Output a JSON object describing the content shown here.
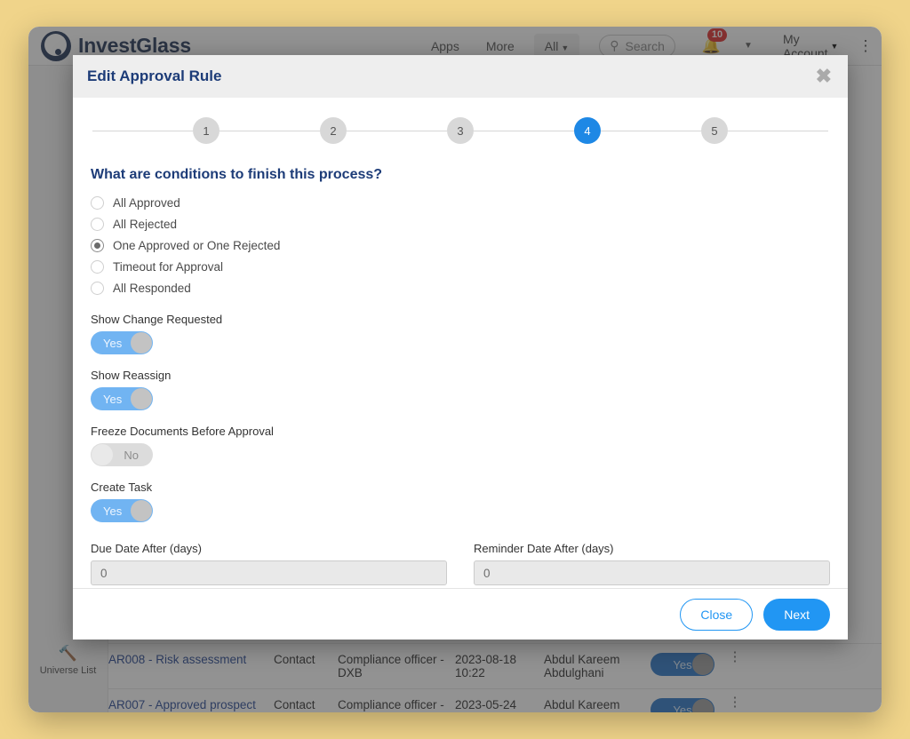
{
  "app": {
    "brand_name": "InvestGlass",
    "nav_links": [
      "Apps",
      "More"
    ],
    "scope_selector": "All",
    "search_placeholder": "Search",
    "notification_count": "10",
    "account_label": "My Account",
    "side_rail": {
      "icon": "gavel-icon",
      "label": "Universe List"
    },
    "background_table": {
      "rows": [
        {
          "name": "AR008 - Risk assessment",
          "type": "Contact",
          "role": "Compliance officer - DXB",
          "date": "2023-08-18 10:22",
          "user": "Abdul Kareem Abdulghani",
          "flag": "Yes"
        },
        {
          "name": "AR007 - Approved prospect",
          "type": "Contact",
          "role": "Compliance officer -",
          "date": "2023-05-24",
          "user": "Abdul Kareem",
          "flag": "Yes"
        }
      ]
    }
  },
  "modal": {
    "title": "Edit Approval Rule",
    "close_icon": "close-icon",
    "stepper": {
      "steps": [
        "1",
        "2",
        "3",
        "4",
        "5"
      ],
      "active_index": 3
    },
    "question": "What are conditions to finish this process?",
    "conditions": [
      {
        "label": "All Approved",
        "selected": false
      },
      {
        "label": "All Rejected",
        "selected": false
      },
      {
        "label": "One Approved or One Rejected",
        "selected": true
      },
      {
        "label": "Timeout for Approval",
        "selected": false
      },
      {
        "label": "All Responded",
        "selected": false
      }
    ],
    "toggles": [
      {
        "label": "Show Change Requested",
        "value": "Yes",
        "on": true
      },
      {
        "label": "Show Reassign",
        "value": "Yes",
        "on": true
      },
      {
        "label": "Freeze Documents Before Approval",
        "value": "No",
        "on": false
      },
      {
        "label": "Create Task",
        "value": "Yes",
        "on": true
      }
    ],
    "fields": [
      {
        "label": "Due Date After (days)",
        "value": "",
        "placeholder": "0"
      },
      {
        "label": "Reminder Date After (days)",
        "value": "",
        "placeholder": "0"
      }
    ],
    "buttons": {
      "close": "Close",
      "next": "Next"
    }
  },
  "colors": {
    "page_background": "#f0d48a",
    "accent_blue": "#2196f3",
    "title_navy": "#1d3c78",
    "toggle_on": "#71b4f2",
    "toggle_off": "#dcdcdc",
    "badge_red": "#e02020"
  }
}
